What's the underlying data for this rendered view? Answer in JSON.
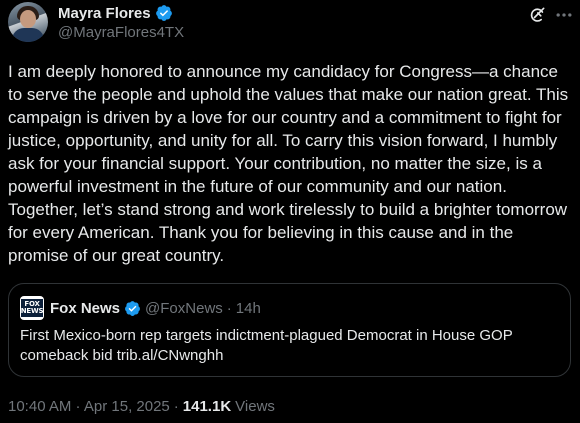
{
  "author": {
    "display_name": "Mayra Flores",
    "handle": "@MayraFlores4TX",
    "verified": true
  },
  "tweet": {
    "text": "I am deeply honored to announce my candidacy for Congress—a chance to serve the people and uphold the values that make our nation great. This campaign is driven by a love for our country and a commitment to fight for justice, opportunity, and unity for all. To carry this vision forward, I humbly ask for your financial support. Your contribution, no matter the size, is a powerful investment in the future of our community and our nation. Together, let’s stand strong and work tirelessly to build a brighter tomorrow for every American. Thank you for believing in this cause and in the promise of our great country."
  },
  "quote": {
    "display_name": "Fox News",
    "handle": "@FoxNews",
    "separator": "·",
    "time": "14h",
    "verified": true,
    "avatar_text_top": "FOX",
    "avatar_text_bottom": "NEWS",
    "text": "First Mexico-born rep targets indictment-plagued Democrat in House GOP comeback bid trib.al/CNwnghh"
  },
  "meta": {
    "timestamp": "10:40 AM · Apr 15, 2025",
    "separator": "·",
    "views_count": "141.1K",
    "views_label": "Views"
  },
  "icons": {
    "verified": "verified-badge-icon",
    "grok": "grok-icon",
    "more": "more-options-icon"
  },
  "colors": {
    "background": "#000000",
    "text_primary": "#e7e9ea",
    "text_secondary": "#71767b",
    "verified_blue": "#1d9bf0",
    "border": "#2f3336"
  }
}
